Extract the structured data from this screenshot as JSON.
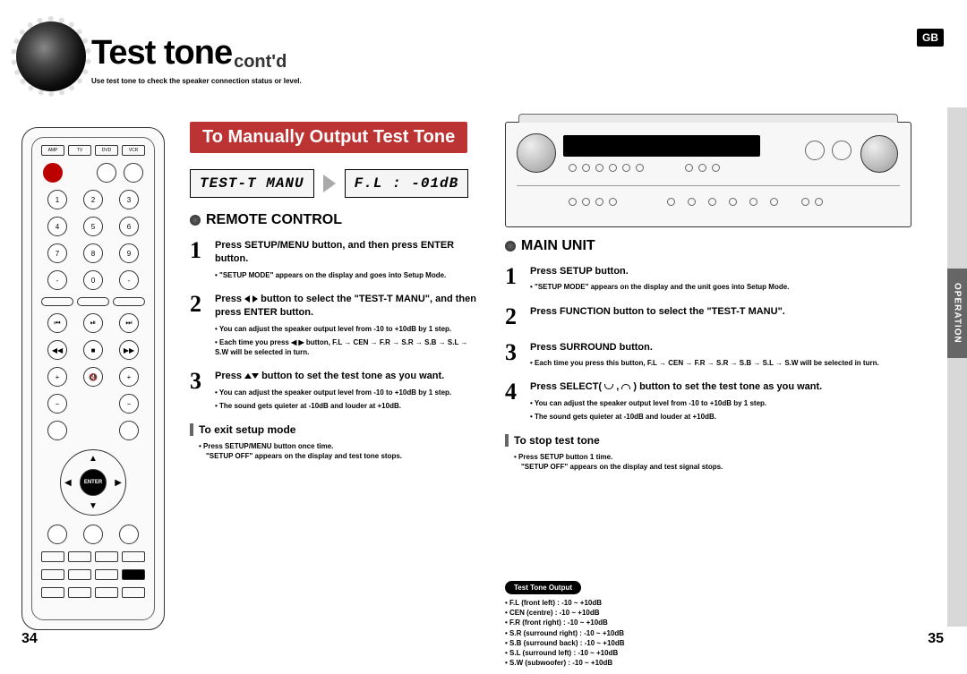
{
  "badge": "GB",
  "title": {
    "main": "Test tone",
    "sub": "cont'd"
  },
  "subtitle": "Use test tone to check the speaker connection status or level.",
  "bar": "To Manually Output Test Tone",
  "lcd": {
    "left": "TEST-T MANU",
    "right": "F.L : -01dB"
  },
  "remote": {
    "heading": "REMOTE CONTROL",
    "steps": [
      {
        "num": "1",
        "bold": "Press SETUP/MENU button, and then press ENTER button.",
        "notes": [
          "\"SETUP MODE\" appears on the display and goes into Setup Mode."
        ]
      },
      {
        "num": "2",
        "bold": "Press ◀ ▶ button to select the \"TEST-T MANU\", and then press ENTER button.",
        "notes": [
          "You can adjust the speaker output level from -10 to +10dB by 1 step.",
          "Each time you press ◀ ▶ button, F.L → CEN → F.R → S.R → S.B → S.L → S.W will be selected in turn."
        ]
      },
      {
        "num": "3",
        "bold": "Press ▲▼ button to set the test tone as you want.",
        "notes": [
          "You can adjust the speaker output level from -10 to +10dB by 1 step.",
          "The sound gets quieter at -10dB and louder at +10dB."
        ]
      }
    ],
    "exit": {
      "head": "To exit setup mode",
      "notes": [
        "Press SETUP/MENU button once time.",
        "\"SETUP OFF\" appears on the display and test tone stops."
      ]
    }
  },
  "main": {
    "heading": "MAIN UNIT",
    "steps": [
      {
        "num": "1",
        "bold": "Press SETUP button.",
        "notes": [
          "\"SETUP MODE\" appears on the display and the unit goes into Setup Mode."
        ]
      },
      {
        "num": "2",
        "bold": "Press FUNCTION button to select the \"TEST-T MANU\".",
        "notes": []
      },
      {
        "num": "3",
        "bold": "Press SURROUND button.",
        "notes": [
          "Each time you press this button, F.L → CEN → F.R → S.R → S.B → S.L → S.W will be selected in turn."
        ]
      },
      {
        "num": "4",
        "bold": "Press SELECT( ⌄ , ⌃ ) button to set the test tone as you want.",
        "notes": [
          "You can adjust the speaker output level from -10 to +10dB by 1 step.",
          "The sound gets quieter at -10dB and louder at +10dB."
        ]
      }
    ],
    "stop": {
      "head": "To stop test tone",
      "notes": [
        "Press SETUP button 1 time.",
        "\"SETUP OFF\" appears on the display and test signal stops."
      ]
    }
  },
  "sidetab": "OPERATION",
  "output": {
    "pill": "Test Tone Output",
    "items": [
      "F.L (front left) : -10 ~ +10dB",
      "CEN (centre) : -10 ~ +10dB",
      "F.R (front right) : -10 ~ +10dB",
      "S.R (surround right) : -10 ~ +10dB",
      "S.B (surround back) : -10 ~ +10dB",
      "S.L (surround left) : -10 ~ +10dB",
      "S.W (subwoofer) : -10 ~ +10dB"
    ]
  },
  "pages": {
    "left": "34",
    "right": "35"
  },
  "remote_layout": {
    "top_rects": [
      "AMP",
      "TV",
      "DVD",
      "VCR"
    ],
    "numpad": [
      [
        "1",
        "2",
        "3"
      ],
      [
        "4",
        "5",
        "6"
      ],
      [
        "7",
        "8",
        "9"
      ],
      [
        "-",
        "0",
        "-"
      ]
    ],
    "enter": "ENTER"
  }
}
